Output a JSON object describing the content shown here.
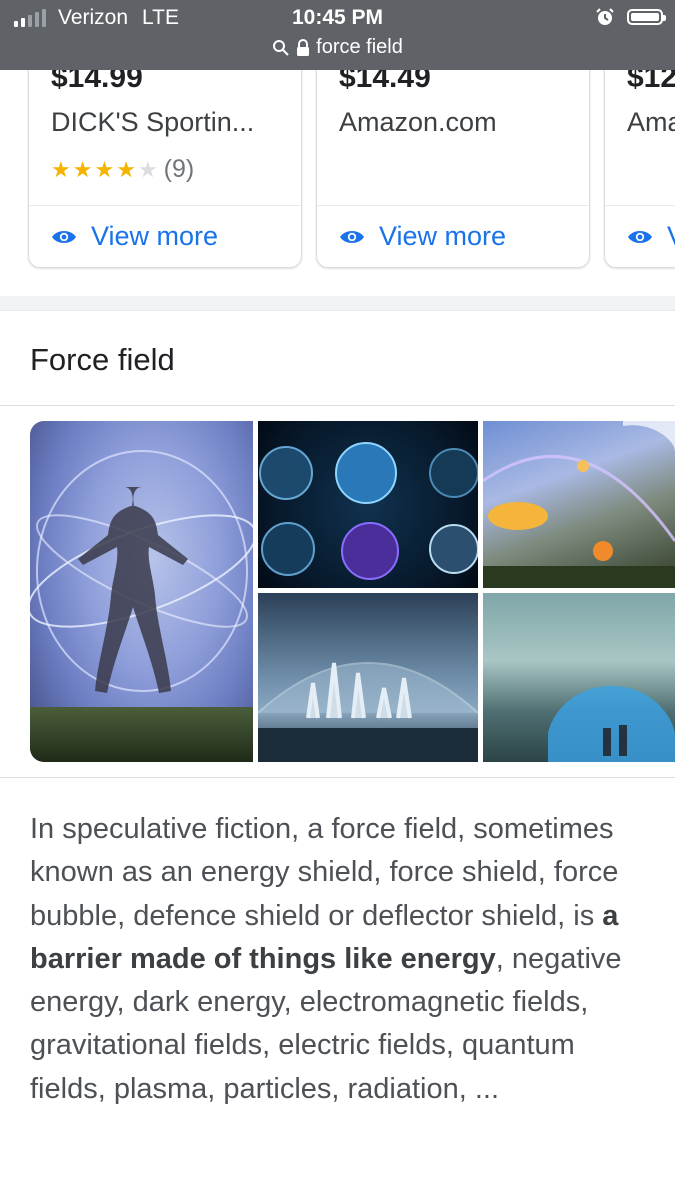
{
  "status_bar": {
    "carrier": "Verizon",
    "network": "LTE",
    "time": "10:45 PM",
    "url": "force field",
    "icons": [
      "signal-icon",
      "alarm-icon",
      "battery-icon",
      "search-icon",
      "lock-icon"
    ]
  },
  "shopping_cards": [
    {
      "price": "$14.99",
      "store": "DICK'S Sportin...",
      "rating_stars": 4,
      "rating_count": "(9)",
      "more_label": "View more"
    },
    {
      "price": "$14.49",
      "store": "Amazon.com",
      "more_label": "View more"
    },
    {
      "price": "$12",
      "store": "Ama",
      "more_label": "V"
    }
  ],
  "knowledge_panel": {
    "title": "Force field",
    "description": {
      "before": "In speculative fiction, a force field, sometimes known as an energy shield, force shield, force bubble, defence shield or deflector shield, is ",
      "bold": "a barrier made of things like energy",
      "after": ", negative energy, dark energy, electromagnetic fields, gravitational fields, electric fields, quantum fields, plasma, particles, radiation, ..."
    }
  },
  "colors": {
    "status_bar": "#5f6368",
    "link_blue": "#1a73e8",
    "star_gold": "#f4b400",
    "text_dark": "#202124",
    "text_body": "#4d5156"
  }
}
